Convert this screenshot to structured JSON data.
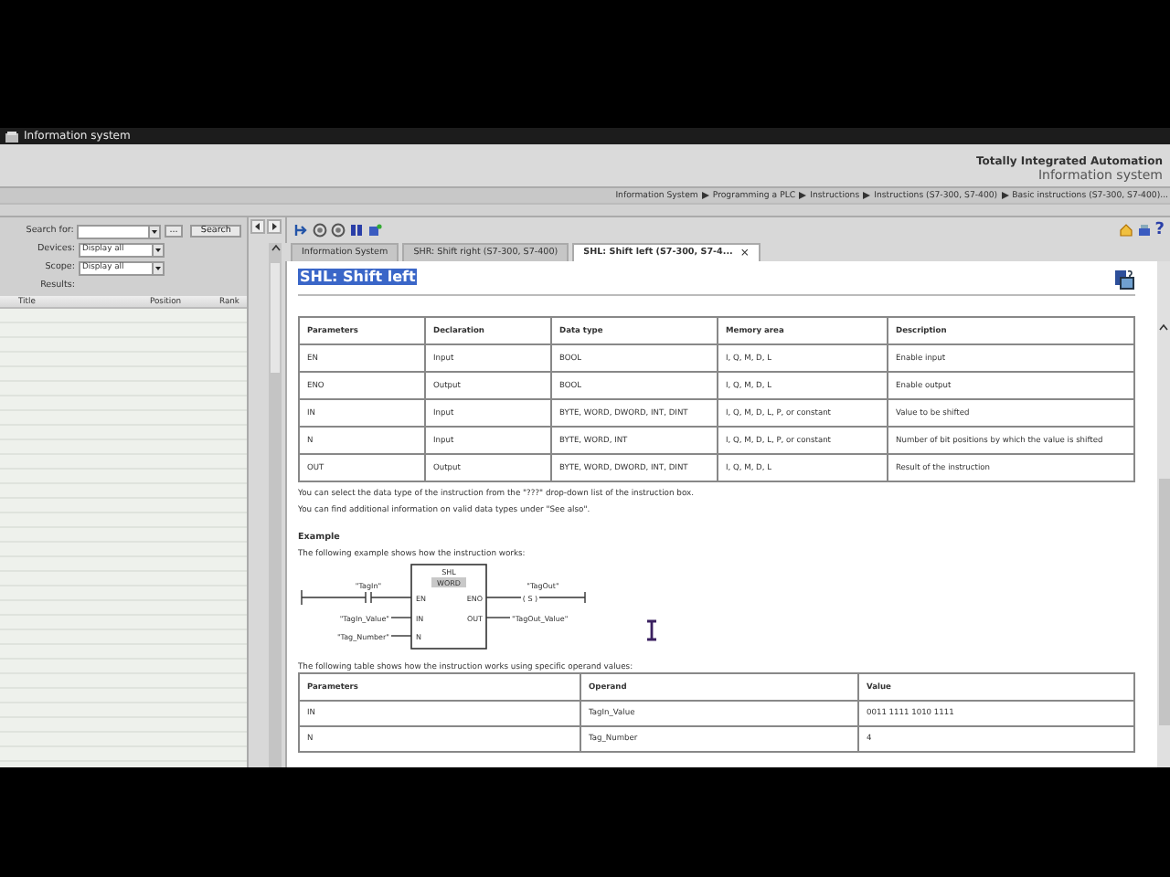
{
  "window": {
    "title": "Information system"
  },
  "header": {
    "brand": "Totally Integrated Automation",
    "subtitle": "Information system"
  },
  "breadcrumb": [
    "Information System",
    "Programming a PLC",
    "Instructions",
    "Instructions (S7-300, S7-400)",
    "Basic instructions (S7-300, S7-400)..."
  ],
  "search": {
    "fields": [
      {
        "label": "Search for:",
        "kind": "combo"
      },
      {
        "label": "Devices:",
        "kind": "select",
        "value": "Display all"
      },
      {
        "label": "Scope:",
        "kind": "select",
        "value": "Display all"
      }
    ],
    "more_button": "...",
    "search_button": "Search",
    "results_label": "Results:",
    "columns": [
      "Title",
      "Position",
      "Rank"
    ]
  },
  "toolbar": {
    "help": "?"
  },
  "tabs": [
    {
      "label": "Information System",
      "selected": false,
      "closable": false
    },
    {
      "label": "SHR: Shift right (S7-300, S7-400)",
      "selected": false,
      "closable": false
    },
    {
      "label": "SHL: Shift left (S7-300, S7-4...",
      "selected": true,
      "closable": true
    }
  ],
  "tab_close": "×",
  "doc": {
    "title": "SHL: Shift left",
    "title_selected": true,
    "params_table": {
      "columns": [
        "Parameters",
        "Declaration",
        "Data type",
        "Memory area",
        "Description"
      ],
      "rows": [
        [
          "EN",
          "Input",
          "BOOL",
          "I, Q, M, D, L",
          "Enable input"
        ],
        [
          "ENO",
          "Output",
          "BOOL",
          "I, Q, M, D, L",
          "Enable output"
        ],
        [
          "IN",
          "Input",
          "BYTE, WORD, DWORD, INT, DINT",
          "I, Q, M, D, L, P, or constant",
          "Value to be shifted"
        ],
        [
          "N",
          "Input",
          "BYTE, WORD, INT",
          "I, Q, M, D, L, P, or constant",
          "Number of bit positions by which the value is shifted"
        ],
        [
          "OUT",
          "Output",
          "BYTE, WORD, DWORD, INT, DINT",
          "I, Q, M, D, L",
          "Result of the instruction"
        ]
      ]
    },
    "notes": [
      "You can select the data type of the instruction from the \"???\" drop-down list of the instruction box.",
      "You can find additional information on valid data types under \"See also\"."
    ],
    "example_heading": "Example",
    "example_intro": "The following example shows how the instruction works:",
    "diagram": {
      "box_title": "SHL",
      "box_type": "WORD",
      "left_pins": [
        "EN",
        "IN",
        "N"
      ],
      "right_pins": [
        "ENO",
        "OUT"
      ],
      "contact_tag": "\"TagIn\"",
      "in_operand": "\"TagIn_Value\"",
      "n_operand": "\"Tag_Number\"",
      "coil_tag": "\"TagOut\"",
      "coil": "( S )",
      "out_operand": "\"TagOut_Value\""
    },
    "table_intro": "The following table shows how the instruction works using specific operand values:",
    "values_table": {
      "columns": [
        "Parameters",
        "Operand",
        "Value"
      ],
      "rows": [
        [
          "IN",
          "TagIn_Value",
          "0011 1111 1010 1111"
        ],
        [
          "N",
          "Tag_Number",
          "4"
        ]
      ]
    }
  }
}
